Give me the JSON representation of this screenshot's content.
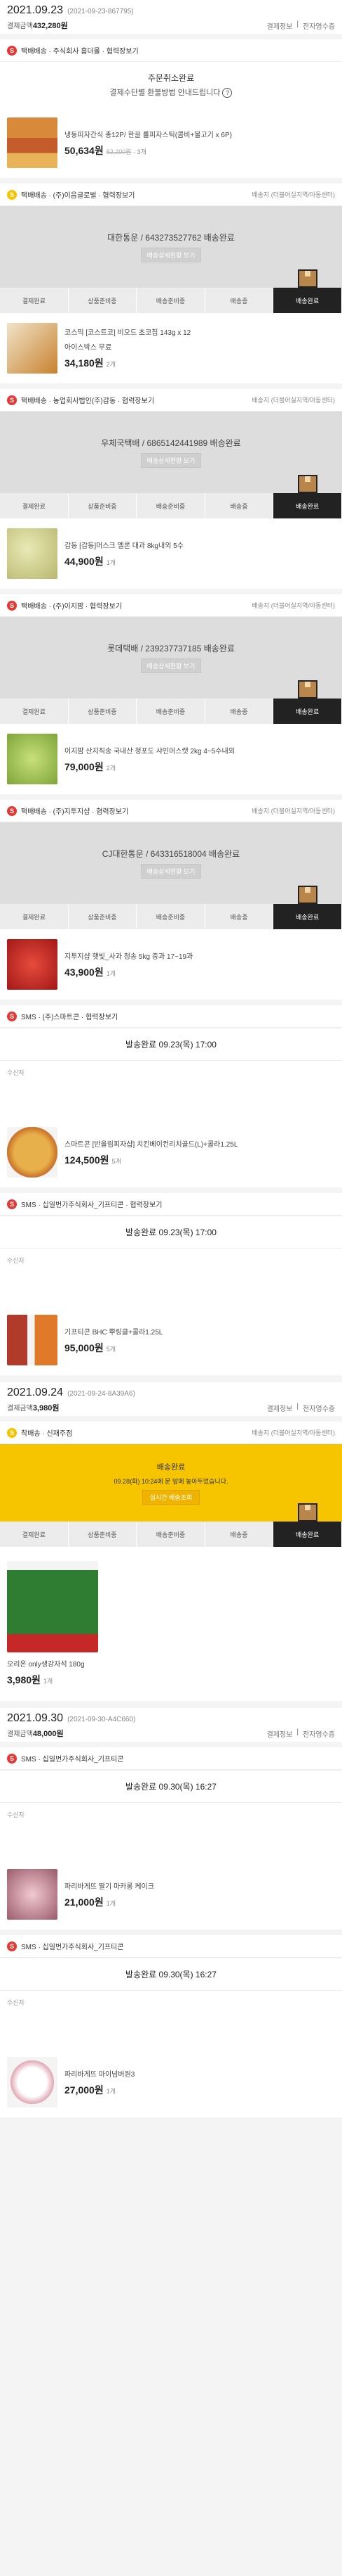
{
  "common": {
    "links": [
      "결제정보",
      "전자영수증"
    ],
    "track_label": "배송지 (더블어실지역/아동센터)",
    "delivery_detail_btn": "배송상세현황 보기",
    "steps": [
      "결제완료",
      "상품준비중",
      "배송준비중",
      "배송중",
      "배송완료"
    ],
    "receiver_label": "수신자"
  },
  "orders": [
    {
      "date": "2021.09.23",
      "code": "(2021-09-23-867795)",
      "total_label": "결제금액",
      "total": "432,280원",
      "notice": {
        "title": "주문취소완료",
        "sub": "결제수단별 환불방법 안내드립니다"
      },
      "items": [
        {
          "seller": "택배배송 · 주식회사 홈더몰 · 협력장보기",
          "product": "냉동피자간식 총12P/ 한끌 롤피자스틱(콤비+불고기 x 6P)",
          "price": "50,634원",
          "orig": "52,200원",
          "qty": "3개"
        },
        {
          "seller": "택배배송 · (주)이음글로벌 · 협력장보기",
          "track": "대한통운 / 643273527762 배송완료",
          "product": "코스믹 [코스트코] 비오드 초코칩 143g x 12",
          "sub": "아이스박스 무료",
          "price": "34,180원",
          "qty": "2개"
        },
        {
          "seller": "택배배송 · 농업회사법인(주)감동 · 협력장보기",
          "track": "우체국택배 / 6865142441989 배송완료",
          "product": "감동 [감동]머스크 멜론 대과 8kg내외 5수",
          "price": "44,900원",
          "qty": "1개"
        },
        {
          "seller": "택배배송 · (주)이지팜 · 협력장보기",
          "track": "롯데택배 / 239237737185 배송완료",
          "product": "이지팜 산지직송 국내산 청포도 샤인머스캣 2kg 4~5수내외",
          "price": "79,000원",
          "qty": "2개"
        },
        {
          "seller": "택배배송 · (주)지투지샵 · 협력장보기",
          "track": "CJ대한통운 / 643316518004 배송완료",
          "product": "지투지샵 햇빛_사과 청송 5kg 중과 17~19과",
          "price": "43,900원",
          "qty": "1개"
        },
        {
          "seller": "SMS · (주)스마트콘 · 협력장보기",
          "ship": "발송완료 09.23(목) 17:00",
          "product": "스마트콘 [반올림피자샵] 치킨베이컨리치골드(L)+콜라1.25L",
          "price": "124,500원",
          "qty": "5개"
        },
        {
          "seller": "SMS · 십일번가주식회사_기프티콘 · 협력장보기",
          "ship": "발송완료 09.23(목) 17:00",
          "product": "기프티콘 BHC 뿌링클+콜라1.25L",
          "price": "95,000원",
          "qty": "5개"
        }
      ]
    },
    {
      "date": "2021.09.24",
      "code": "(2021-09-24-8A39A6)",
      "total_label": "결제금액",
      "total": "3,980원",
      "items": [
        {
          "seller": "착배송 · 신재주점",
          "yellow": {
            "title": "배송완료",
            "sub": "09.28(화) 10:24에 문 앞에 놓아두었습니다.",
            "btn": "실시간 배송조회"
          },
          "product": "오리온 only생강자석 180g",
          "price": "3,980원",
          "qty": "1개"
        }
      ]
    },
    {
      "date": "2021.09.30",
      "code": "(2021-09-30-A4C660)",
      "total_label": "결제금액",
      "total": "48,000원",
      "items": [
        {
          "seller": "SMS · 십일번가주식회사_기프티콘",
          "ship": "발송완료 09.30(목) 16:27",
          "product": "파리바게뜨 딸기 마카롱 케이크",
          "price": "21,000원",
          "qty": "1개"
        },
        {
          "seller": "SMS · 십일번가주식회사_기프티콘",
          "ship": "발송완료 09.30(목) 16:27",
          "product": "파리바게뜨 마이넘버원3",
          "price": "27,000원",
          "qty": "1개"
        }
      ]
    }
  ],
  "colors": {
    "accent_red": "#e53935",
    "accent_yellow": "#f6c500",
    "step_active": "#222222"
  }
}
